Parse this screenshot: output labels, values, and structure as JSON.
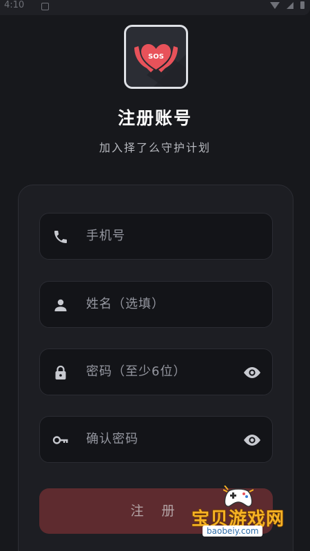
{
  "status_bar": {
    "time": "4:10"
  },
  "app": {
    "icon_text": "SOS",
    "title": "注册账号",
    "subtitle": "加入择了么守护计划"
  },
  "form": {
    "phone_placeholder": "手机号",
    "name_placeholder": "姓名（选填）",
    "password_placeholder": "密码（至少6位）",
    "confirm_placeholder": "确认密码",
    "submit_label": "注 册"
  },
  "watermark": {
    "brand": "宝贝游戏网",
    "url": "baobeiy.com"
  },
  "colors": {
    "background": "#17181c",
    "card": "#1d1e23",
    "field": "#131418",
    "accent_red": "#e8525a",
    "submit": "#5e2b2f",
    "icon_gray": "#c8cad0"
  },
  "icons": {
    "phone": "phone-icon",
    "person": "person-icon",
    "lock": "lock-icon",
    "key": "key-icon",
    "eye": "eye-icon"
  }
}
